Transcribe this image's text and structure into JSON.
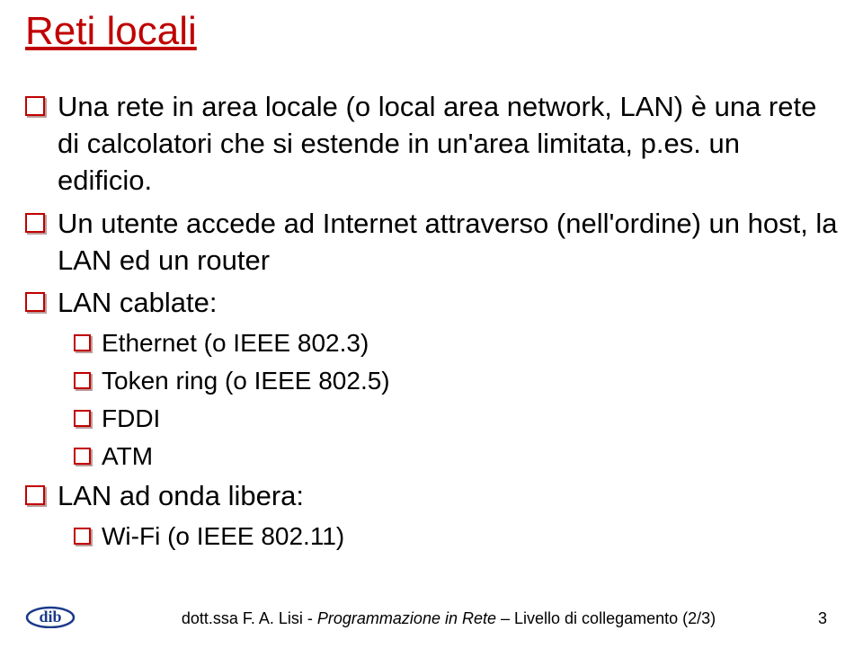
{
  "title": "Reti locali",
  "bullets": [
    {
      "level": 1,
      "text": "Una rete in area locale (o local area network, LAN) è una rete di calcolatori che si estende in un'area limitata, p.es. un edificio."
    },
    {
      "level": 1,
      "text": "Un utente accede ad Internet attraverso (nell'ordine) un host, la LAN ed un router"
    },
    {
      "level": 1,
      "text": "LAN cablate:"
    },
    {
      "level": 2,
      "text": "Ethernet (o IEEE 802.3)"
    },
    {
      "level": 2,
      "text": "Token ring (o IEEE 802.5)"
    },
    {
      "level": 2,
      "text": "FDDI"
    },
    {
      "level": 2,
      "text": "ATM"
    },
    {
      "level": 1,
      "text": "LAN ad onda libera:"
    },
    {
      "level": 2,
      "text": "Wi-Fi (o IEEE 802.11)"
    }
  ],
  "footer": {
    "author": "dott.ssa F. A. Lisi - ",
    "italic_part": "Programmazione in Rete",
    "suffix": " – Livello di collegamento (2/3)"
  },
  "page_number": "3",
  "logo_text": "dib"
}
